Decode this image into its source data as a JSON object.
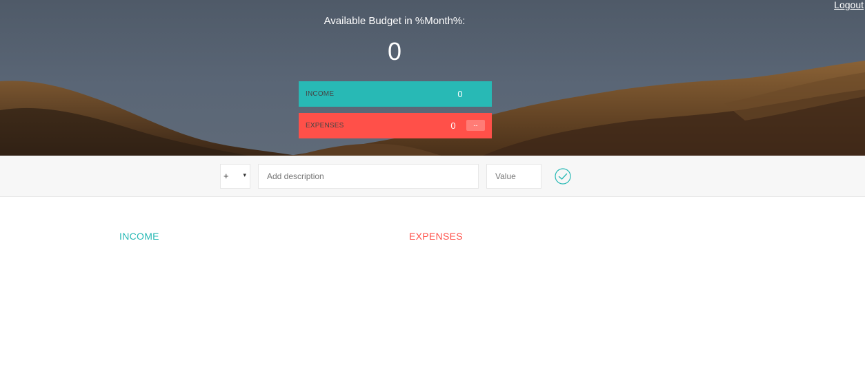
{
  "header": {
    "logout_label": "Logout",
    "budget_title": "Available Budget in %Month%:",
    "budget_value": "0",
    "income": {
      "label": "INCOME",
      "value": "0"
    },
    "expenses": {
      "label": "EXPENSES",
      "value": "0",
      "percentage": "--"
    }
  },
  "add_form": {
    "type_value": "+",
    "type_caret": "▾",
    "description_placeholder": "Add description",
    "value_placeholder": "Value",
    "submit_icon": "checkmark-circle-icon"
  },
  "lists": {
    "income_title": "INCOME",
    "expenses_title": "EXPENSES"
  },
  "colors": {
    "income": "#28b9b5",
    "expenses": "#ff5049"
  }
}
